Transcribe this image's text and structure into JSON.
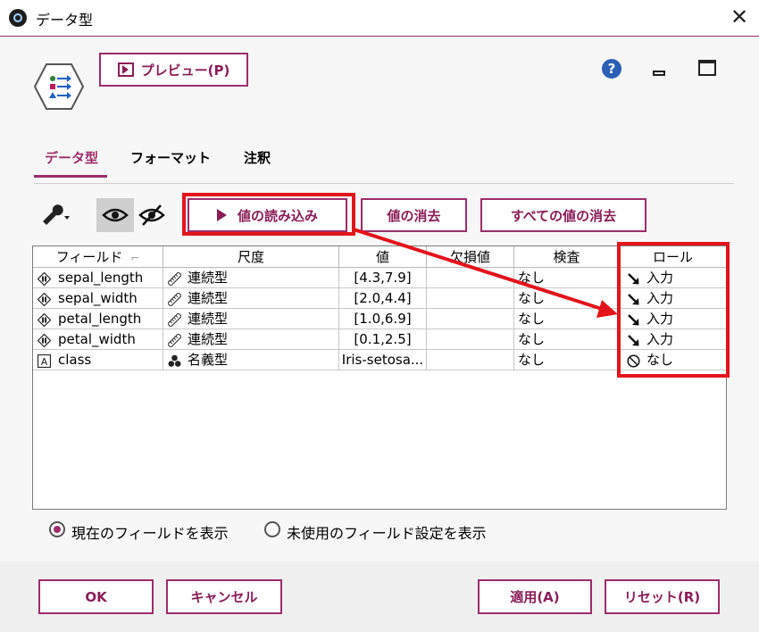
{
  "window": {
    "title": "データ型"
  },
  "toolbar": {
    "preview_label": "プレビュー(P)"
  },
  "tabs": [
    {
      "label": "データ型"
    },
    {
      "label": "フォーマット"
    },
    {
      "label": "注釈"
    }
  ],
  "actions": {
    "read_values": "値の読み込み",
    "clear_values": "値の消去",
    "clear_all_values": "すべての値の消去"
  },
  "table": {
    "columns": [
      "フィールド",
      "尺度",
      "値",
      "欠損値",
      "検査",
      "ロール"
    ],
    "rows": [
      {
        "field": "sepal_length",
        "field_icon": "continuous-field-icon",
        "measure": "連続型",
        "measure_icon": "ruler-icon",
        "values": "[4.3,7.9]",
        "missing": "",
        "check": "なし",
        "role": "入力",
        "role_icon": "input-arrow-icon"
      },
      {
        "field": "sepal_width",
        "field_icon": "continuous-field-icon",
        "measure": "連続型",
        "measure_icon": "ruler-icon",
        "values": "[2.0,4.4]",
        "missing": "",
        "check": "なし",
        "role": "入力",
        "role_icon": "input-arrow-icon"
      },
      {
        "field": "petal_length",
        "field_icon": "continuous-field-icon",
        "measure": "連続型",
        "measure_icon": "ruler-icon",
        "values": "[1.0,6.9]",
        "missing": "",
        "check": "なし",
        "role": "入力",
        "role_icon": "input-arrow-icon"
      },
      {
        "field": "petal_width",
        "field_icon": "continuous-field-icon",
        "measure": "連続型",
        "measure_icon": "ruler-icon",
        "values": "[0.1,2.5]",
        "missing": "",
        "check": "なし",
        "role": "入力",
        "role_icon": "input-arrow-icon"
      },
      {
        "field": "class",
        "field_icon": "string-field-icon",
        "measure": "名義型",
        "measure_icon": "nominal-dots-icon",
        "values": "Iris-setosa...",
        "missing": "",
        "check": "なし",
        "role": "なし",
        "role_icon": "none-circle-icon"
      }
    ]
  },
  "view_options": {
    "current_fields": "現在のフィールドを表示",
    "unused_settings": "未使用のフィールド設定を表示",
    "selected": "current_fields"
  },
  "footer": {
    "ok": "OK",
    "cancel": "キャンセル",
    "apply": "適用(A)",
    "reset": "リセット(R)"
  },
  "colors": {
    "accent": "#9c2c6a",
    "highlight": "#e3141b",
    "help": "#2a5fb5"
  }
}
